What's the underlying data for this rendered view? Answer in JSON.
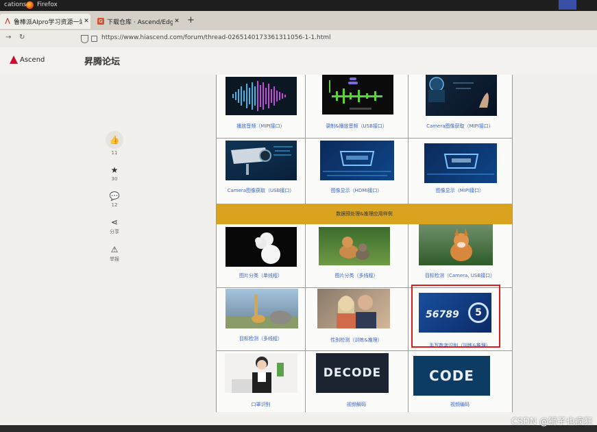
{
  "os_bar": {
    "apps_label": "cations",
    "browser_label": "Firefox"
  },
  "tabs": [
    {
      "label": "鲁棒派AIpro学习资源一站式",
      "icon": "ascend-logo-icon"
    },
    {
      "label": "下载仓库 · Ascend/EdgeAi",
      "icon": "gitee-icon"
    }
  ],
  "urlbar": {
    "url": "https://www.hiascend.com/forum/thread-0265140173361311056-1-1.html"
  },
  "site": {
    "logo_text": "Ascend",
    "forum_title": "昇腾论坛"
  },
  "sidebar": {
    "like_count": "11",
    "favorite_count": "30",
    "comment_count": "12",
    "share_label": "分享",
    "report_label": "举报"
  },
  "gallery": {
    "rows": [
      {
        "items": [
          {
            "caption": "播放音频（MIPI接口）",
            "thumb": "audio-waveform"
          },
          {
            "caption": "录制&播放音频（USB接口）",
            "thumb": "audio-editor"
          },
          {
            "caption": "Camera图像获取（MIPI接口）",
            "thumb": "camera-hand"
          }
        ]
      },
      {
        "items": [
          {
            "caption": "Camera图像获取（USB接口）",
            "thumb": "cctv-camera"
          },
          {
            "caption": "图像显示（HDMI接口）",
            "thumb": "hdmi-port"
          },
          {
            "caption": "图像显示（MIPI接口）",
            "thumb": "mipi-display"
          }
        ]
      },
      {
        "items": [
          {
            "caption": "图片分类（单线程）",
            "thumb": "poodle"
          },
          {
            "caption": "图片分类（多线程）",
            "thumb": "dog-and-cat"
          },
          {
            "caption": "目标检测（Camera, USB接口）",
            "thumb": "shiba-dog"
          }
        ]
      },
      {
        "items": [
          {
            "caption": "目标检测（多线程）",
            "thumb": "giraffe-elephant"
          },
          {
            "caption": "性别检测（训练&推理）",
            "thumb": "couple"
          },
          {
            "caption": "手写数字识别（训练&推理）",
            "thumb": "handwritten-digits",
            "digits": "56789",
            "badge": "5"
          }
        ]
      },
      {
        "items": [
          {
            "caption": "口罩识别",
            "thumb": "face-mask"
          },
          {
            "caption": "视频解码",
            "thumb": "decode",
            "word": "DECODE"
          },
          {
            "caption": "视频编码",
            "thumb": "encode",
            "word": "CODE"
          }
        ]
      }
    ],
    "section_banner": "数据预处理&推理应用样例"
  },
  "watermark": "CSDN @狮子也疯狂"
}
